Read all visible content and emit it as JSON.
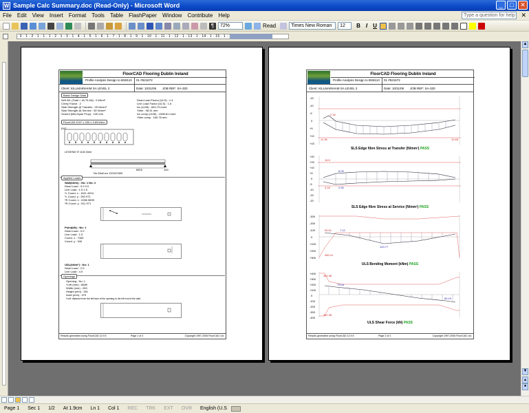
{
  "window": {
    "title": "Sample Calc Summary.doc (Read-Only) - Microsoft Word",
    "min": "_",
    "max": "□",
    "close": "✕"
  },
  "menu": {
    "items": [
      "File",
      "Edit",
      "View",
      "Insert",
      "Format",
      "Tools",
      "Table",
      "FlashPaper",
      "Window",
      "Contribute",
      "Help"
    ],
    "ask_placeholder": "Type a question for help",
    "close": "✕"
  },
  "toolbar": {
    "zoom": "72%",
    "read": "Read",
    "font": "Times New Roman",
    "size": "12",
    "bold": "B",
    "italic": "I",
    "underline": "U",
    "colors": {
      "accent": "#f0c14b",
      "font_color": "#cc0000"
    }
  },
  "ruler": {
    "marks": "· 3 · 1 · 2 · 1 · 1 · 1 · 2 · 1 · 3 · 1 · 4 · 1 · 5 · 1 · 6 · 1 · 7 · 1 · 8 · 1 · 9 · 1 · 10 · 1 · 11 · 1 · 12 · 1 · 13 · 1 · 14 · 1 · 15 · 1 · 16 · 1 · 17 · 1 · 18 ·"
  },
  "status": {
    "page": "Page 1",
    "sec": "Sec 1",
    "of": "1/2",
    "at": "At 1.9cm",
    "ln": "Ln 1",
    "col": "Col 1",
    "rec": "REC",
    "trk": "TRK",
    "ext": "EXT",
    "ovr": "OVR",
    "lang": "English (U.S"
  },
  "doc": {
    "brand": "FloorCAD   Flooring Dublin Ireland",
    "profile": "Profile Analysis Design to BS8110",
    "job_no": "01 #521672",
    "client": "Client: KILLMAINHAM SA LEVEL 2",
    "date": "Date: 10/11/06",
    "job_ref": "JOB REF: SA-320",
    "footer_left": "Results generated using FloorCAD 12.9.5",
    "footer_copy": "Copyright 1997-2006 FloorCAD Ltd.",
    "page1_no": "Page 1 of 2",
    "page2_no": "Page 2 of 2"
  },
  "page1": {
    "basic_tab": "Basic Design Data",
    "basic_left": [
      "Self Wt. (Total = 40.76 kN)  :  0 kN/m²",
      "Creep Factor                 :  2",
      "Slab Strength @ Transfer     :  25 N/mm²",
      "Slab Strength @ Service      :  50 N/mm²",
      "Screed (Mid-Span Prop)       :  100 mm"
    ],
    "basic_right": [
      "Dead Load Factor (ULS)  :  1.4",
      "Live Load Factor (ULS)  :  1.6",
      "Ixx (x106)              :  604.73 mm4",
      "Ybtm                    :  98.31 mm",
      "Ixx comp (x106)         :  1998.61 mm4",
      "Ybtm comp               :  160.76 mm"
    ],
    "section_tab": "FloorCAD 1197 x 200 x 3.69 kN/m",
    "legend": "LEGEND     Φ 11/8.3mm",
    "dim_a": "1197",
    "dim_b": "6815",
    "dim_c": "100",
    "dim_d": "No./Dia/Len 10/10/2300",
    "applied_tab": "Applied Loads",
    "walls_head": "Wall(kN/m)   : No: 1   No: 2",
    "walls_rows": [
      "Dead Load :    0.0      0.0",
      "Live Load :    1.5      1.5",
      "*L Coord. x :  1611     4204",
      "*L Coord. y :   250      971",
      "*R Coord. x :  2266     5699",
      "*R Coord. y :   511      971"
    ],
    "point_head": "Point(kN)    : No: 1",
    "point_rows": [
      "Dead Load :    0.0",
      "Live Load :    1.5",
      "Coord. x  :   7283",
      "Coord. y  :    340"
    ],
    "udl_head": "UDL(kN/m²)   : No: 1",
    "udl_rows": [
      "Dead Load :    2.0",
      "Live Load :    4.0"
    ],
    "openings_tab": "Openings",
    "open_rows": [
      "Opening   : No: 1",
      "*Left (mm)  :   6689",
      "Width (mm)  :    263",
      "Height (mm) :    261",
      "Inset (mm)  :    379"
    ],
    "open_note": "*Left: distance from the left face of the opening to the left end of the slab."
  },
  "page2": {
    "charts": [
      {
        "title": "SLS Edge fibre Stress at Transfer (N/mm²)",
        "pass": "PASS",
        "left_ticks": [
          "-15",
          "-10",
          "-5",
          "0",
          "+5",
          "+10",
          "+15"
        ],
        "labels": [
          "2.16",
          "11.36",
          "10.65"
        ],
        "side_left": "T\nO\nP",
        "side_right": "T\nO\nP"
      },
      {
        "title": "SLS Edge fibre Stress at Service (N/mm²)",
        "pass": "PASS",
        "left_ticks": [
          "+20",
          "+15",
          "+10",
          "+5",
          "0",
          "-5",
          "-10",
          "-15",
          "-20"
        ],
        "labels": [
          "16.5",
          "8.09",
          "3.18",
          "2.94"
        ],
        "side_left": "T\nO\nP",
        "side_right": "B\nT\nM"
      },
      {
        "title": "ULS Bending Moment (kNm)",
        "pass": "PASS",
        "left_ticks": [
          "-300",
          "-200",
          "-100",
          "0",
          "+100",
          "+200",
          "+300"
        ],
        "labels": [
          "95.51",
          "7.12",
          "143.77",
          "260.41"
        ]
      },
      {
        "title": "ULS Shear Force (kN)",
        "pass": "PASS",
        "left_ticks": [
          "+400",
          "+300",
          "+200",
          "+100",
          "0",
          "-100",
          "-200",
          "-300",
          "-400"
        ],
        "labels": [
          "361.98",
          "79.04",
          "83.19",
          "361.98"
        ]
      }
    ]
  }
}
